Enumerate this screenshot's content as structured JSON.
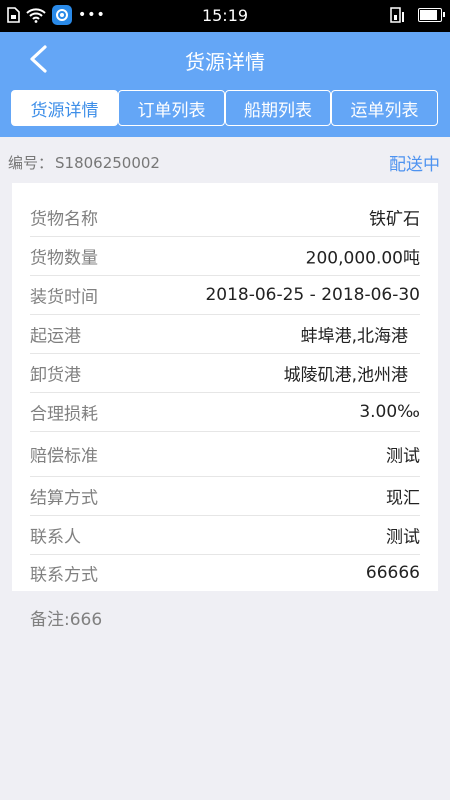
{
  "status_bar": {
    "time": "15:19",
    "icons": [
      "sim-icon",
      "wifi-icon",
      "app-notification-icon",
      "more-dots-icon",
      "signal-icon",
      "battery-icon"
    ]
  },
  "nav": {
    "title": "货源详情",
    "back_icon": "back-arrow-icon"
  },
  "tabs": [
    {
      "label": "货源详情",
      "active": true
    },
    {
      "label": "订单列表",
      "active": false
    },
    {
      "label": "船期列表",
      "active": false
    },
    {
      "label": "运单列表",
      "active": false
    }
  ],
  "info": {
    "number_label": "编号：",
    "number_value": "S1806250002",
    "status": "配送中"
  },
  "details": [
    {
      "label": "货物名称",
      "value": "铁矿石"
    },
    {
      "label": "货物数量",
      "value": "200,000.00吨"
    },
    {
      "label": "装货时间",
      "value": "2018-06-25 - 2018-06-30"
    },
    {
      "label": "起运港",
      "value": "蚌埠港,北海港"
    },
    {
      "label": "卸货港",
      "value": "城陵矶港,池州港"
    },
    {
      "label": "合理损耗",
      "value": "3.00‰"
    },
    {
      "label": "赔偿标准",
      "value": "测试"
    },
    {
      "label": "结算方式",
      "value": "现汇"
    },
    {
      "label": "联系人",
      "value": "测试"
    },
    {
      "label": "联系方式",
      "value": "66666"
    }
  ],
  "remark": "备注:666",
  "colors": {
    "primary": "#64a6f6",
    "status": "#4e93f0",
    "background": "#efeff4"
  }
}
